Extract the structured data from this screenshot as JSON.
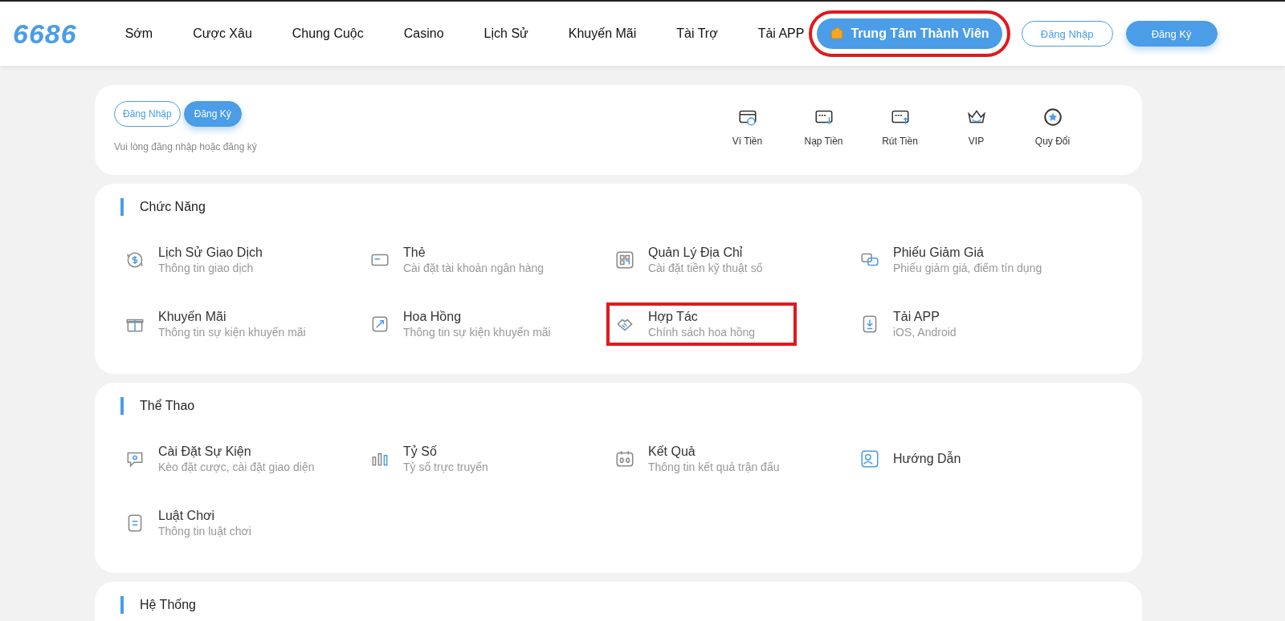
{
  "header": {
    "logo": "6686",
    "nav": [
      "Sớm",
      "Cược Xâu",
      "Chung Cuộc",
      "Casino",
      "Lịch Sử",
      "Khuyến Mãi",
      "Tài Trợ",
      "Tải APP"
    ],
    "member_center": {
      "label": "Trung Tâm Thành Viên",
      "highlighted": true
    },
    "login": "Đăng Nhập",
    "register": "Đăng Ký"
  },
  "account": {
    "login": "Đăng Nhập",
    "register": "Đăng Ký",
    "hint": "Vui lòng đăng nhập hoặc đăng ký",
    "shortcuts": [
      "Ví Tiền",
      "Nạp Tiền",
      "Rút Tiền",
      "VIP",
      "Quy Đổi"
    ]
  },
  "sections": [
    {
      "title": "Chức Năng",
      "items": [
        {
          "title": "Lịch Sử Giao Dịch",
          "subtitle": "Thông tin giao dịch",
          "highlighted": false
        },
        {
          "title": "Thẻ",
          "subtitle": "Cài đặt tài khoản ngân hàng",
          "highlighted": false
        },
        {
          "title": "Quản Lý Địa Chỉ",
          "subtitle": "Cài đặt tiền kỹ thuật số",
          "highlighted": false
        },
        {
          "title": "Phiếu Giảm Giá",
          "subtitle": "Phiếu giảm giá, điểm tín dụng",
          "highlighted": false
        },
        {
          "title": "Khuyến Mãi",
          "subtitle": "Thông tin sự kiện khuyến mãi",
          "highlighted": false
        },
        {
          "title": "Hoa Hồng",
          "subtitle": "Thông tin sự kiện khuyến mãi",
          "highlighted": false
        },
        {
          "title": "Hợp Tác",
          "subtitle": "Chính sách hoa hồng",
          "highlighted": true
        },
        {
          "title": "Tải APP",
          "subtitle": "iOS, Android",
          "highlighted": false
        }
      ]
    },
    {
      "title": "Thể Thao",
      "items": [
        {
          "title": "Cài Đặt Sự Kiện",
          "subtitle": "Kèo đặt cược, cài đặt giao diện",
          "highlighted": false
        },
        {
          "title": "Tỷ Số",
          "subtitle": "Tỷ số trực truyến",
          "highlighted": false
        },
        {
          "title": "Kết Quả",
          "subtitle": "Thông tin kết quả trận đấu",
          "highlighted": false
        },
        {
          "title": "Hướng Dẫn",
          "highlighted": false
        },
        {
          "title": "Luật Chơi",
          "subtitle": "Thông tin luật chơi",
          "highlighted": false
        }
      ]
    },
    {
      "title": "Hệ Thống"
    }
  ]
}
